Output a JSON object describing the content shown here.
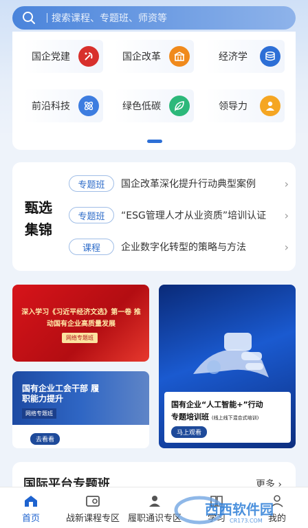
{
  "search": {
    "placeholder": "搜索课程、专题班、师资等"
  },
  "categories": [
    {
      "label": "国企党建",
      "icon": "party-emblem-icon",
      "color": "#d8302c"
    },
    {
      "label": "国企改革",
      "icon": "building-icon",
      "color": "#f08a1c"
    },
    {
      "label": "经济学",
      "icon": "coins-stack-icon",
      "color": "#2d6fd6"
    },
    {
      "label": "前沿科技",
      "icon": "atom-icon",
      "color": "#3d7de0"
    },
    {
      "label": "绿色低碳",
      "icon": "leaf-icon",
      "color": "#2cb87a"
    },
    {
      "label": "领导力",
      "icon": "person-icon",
      "color": "#f5a623"
    }
  ],
  "curated": {
    "title": "甄选集锦",
    "items": [
      {
        "tag": "专题班",
        "text": "国企改革深化提升行动典型案例"
      },
      {
        "tag": "专题班",
        "text": "“ESG管理人才从业资质”培训认证"
      },
      {
        "tag": "课程",
        "text": "企业数字化转型的策略与方法"
      }
    ]
  },
  "banners": {
    "b1": {
      "title": "深入学习《习近平经济文选》第一卷 推动国有企业高质量发展",
      "badge": "网络专题班"
    },
    "b2": {
      "title": "国有企业工会干部 履职能力提升",
      "badge": "网络专题班",
      "button": "去看看"
    },
    "b3": {
      "line1": "国有企业“人工智能+”行动",
      "line2": "专题培训班",
      "line2_note": "(线上线下混合式培训)",
      "button": "马上观看"
    }
  },
  "intl": {
    "title": "国际平台专题班",
    "more": "更多"
  },
  "nav": [
    {
      "label": "首页",
      "icon": "home-icon",
      "active": true
    },
    {
      "label": "战新课程专区",
      "icon": "course-icon",
      "active": false
    },
    {
      "label": "履职通识专区",
      "icon": "user-badge-icon",
      "active": false
    },
    {
      "label": "学习",
      "icon": "study-icon",
      "active": false
    },
    {
      "label": "我的",
      "icon": "profile-icon",
      "active": false
    }
  ],
  "watermark": {
    "text": "西西软件园",
    "sub": "CR173.COM"
  }
}
